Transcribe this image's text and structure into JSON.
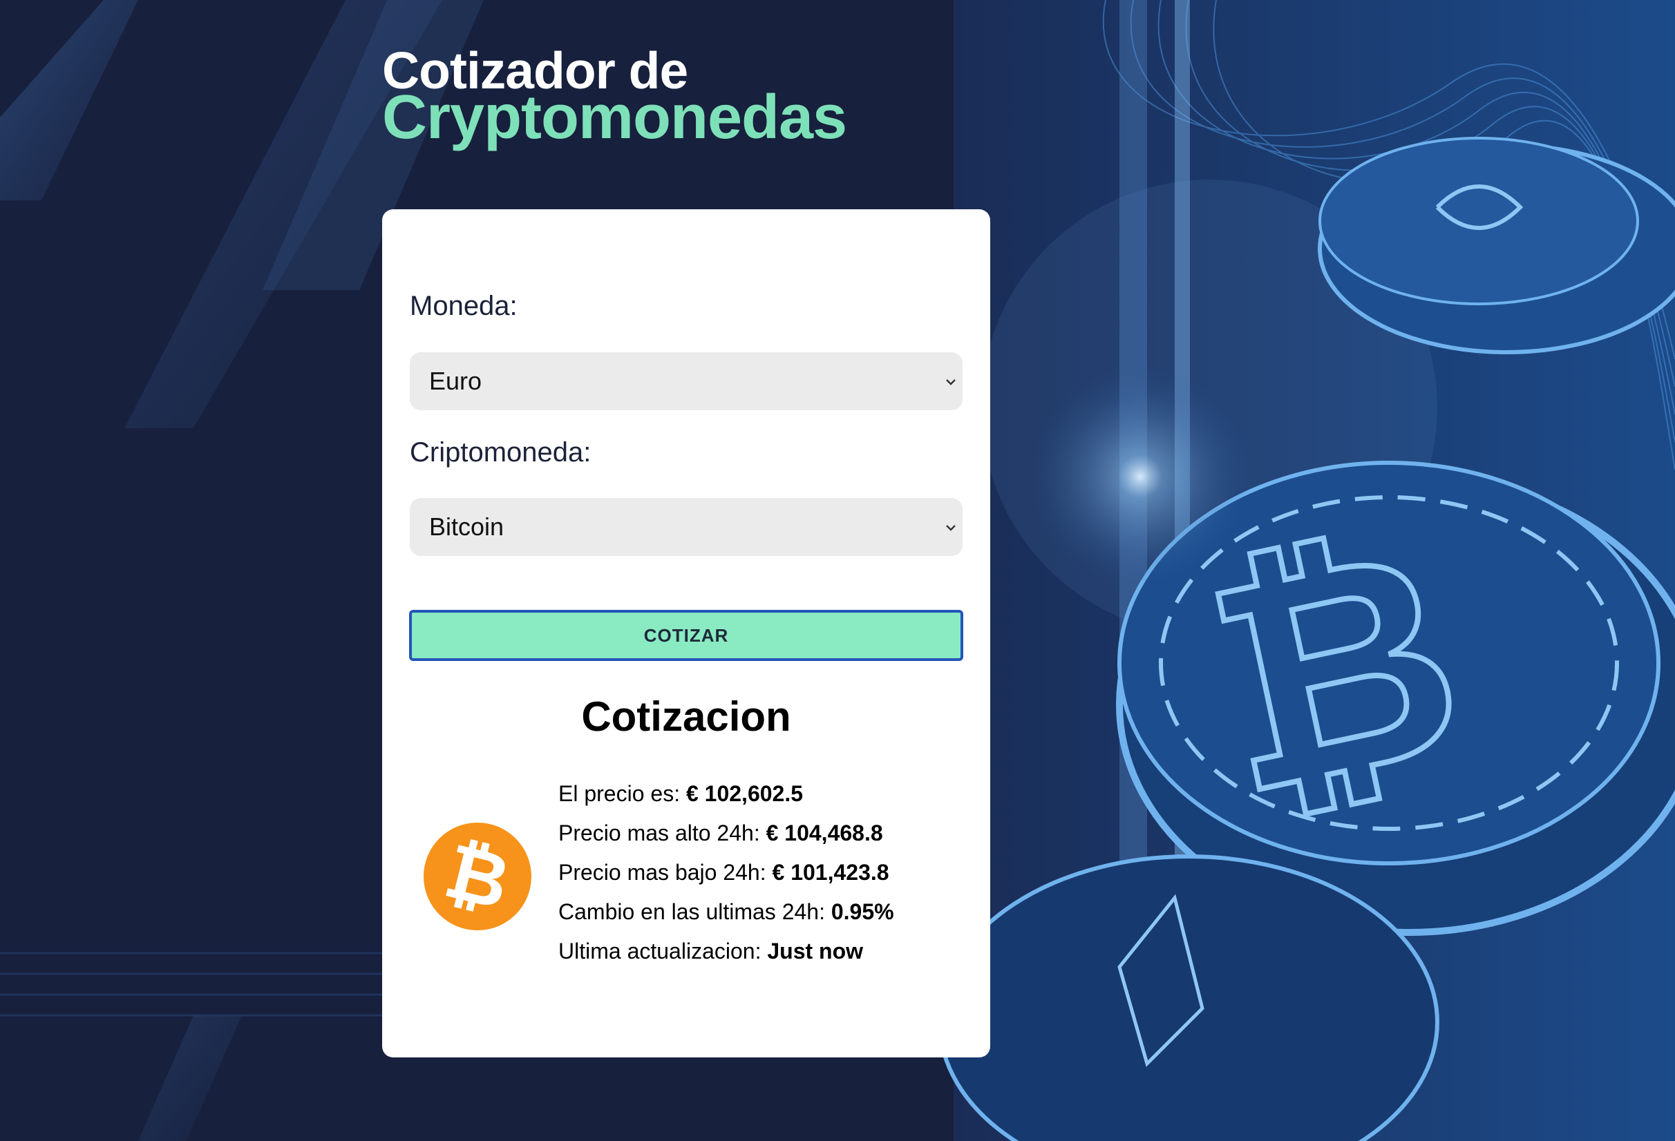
{
  "header": {
    "title_line1": "Cotizador de",
    "title_line2": "Cryptomonedas"
  },
  "form": {
    "currency_label": "Moneda:",
    "currency_selected": "Euro",
    "crypto_label": "Criptomoneda:",
    "crypto_selected": "Bitcoin",
    "submit_label": "COTIZAR"
  },
  "result": {
    "title": "Cotizacion",
    "coin_icon": "bitcoin-icon",
    "price_label": "El precio es:",
    "price_value": "€ 102,602.5",
    "high_label": "Precio mas alto 24h:",
    "high_value": "€ 104,468.8",
    "low_label": "Precio mas bajo 24h:",
    "low_value": "€ 101,423.8",
    "change_label": "Cambio en las ultimas 24h:",
    "change_value": "0.95%",
    "updated_label": "Ultima actualizacion:",
    "updated_value": "Just now"
  },
  "colors": {
    "background": "#17203d",
    "accent_green": "#7ee0b8",
    "button_bg": "#8aeac2",
    "button_border": "#2356b8",
    "bitcoin_orange": "#f7931a"
  }
}
